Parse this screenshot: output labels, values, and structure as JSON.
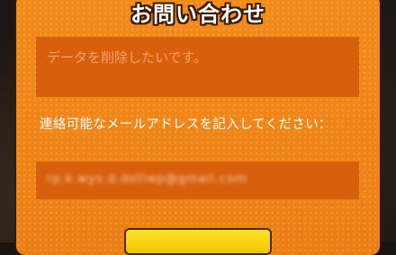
{
  "dialog": {
    "title": "お問い合わせ",
    "message_placeholder": "データを削除したいです。",
    "email_label": "連絡可能なメールアドレスを記入してください：",
    "email_value": "rp.k.wys.d.dotlwp@gmail.com"
  },
  "colors": {
    "panel": "#f08a1c",
    "field": "#d85f0c",
    "button": "#ffd816"
  }
}
